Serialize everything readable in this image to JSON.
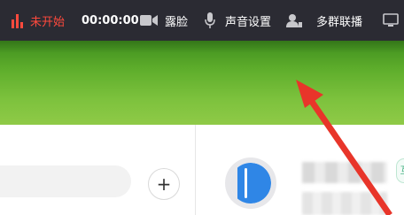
{
  "toolbar": {
    "status_label": "未开始",
    "timer": "00:00:00",
    "face_label": "露脸",
    "sound_label": "声音设置",
    "multi_label": "多群联播"
  },
  "contact": {
    "tag_label": "互"
  },
  "add_button_label": "+",
  "colors": {
    "toolbar_bg": "#2b2b33",
    "status_red": "#ff4a3d",
    "banner_green": "#6cb435",
    "arrow_red": "#e8352a",
    "avatar_blue": "#2f86e6"
  },
  "icons": {
    "status": "signal-bars-icon",
    "camera": "video-camera-icon",
    "microphone": "microphone-icon",
    "multi": "user-broadcast-icon",
    "screen": "screen-share-icon"
  }
}
